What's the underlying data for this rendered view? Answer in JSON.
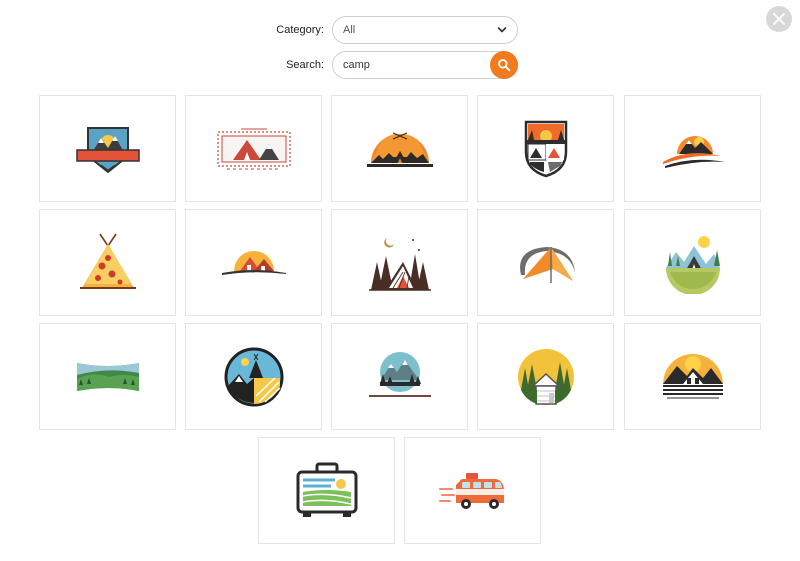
{
  "filters": {
    "category_label": "Category:",
    "category_value": "All",
    "search_label": "Search:",
    "search_value": "camp"
  },
  "icons": {
    "close": "close-icon",
    "dropdown": "chevron-down-icon",
    "search": "search-icon"
  },
  "colors": {
    "accent": "#f47a20",
    "close_bg": "#d8d8d8",
    "tile_border": "#e4e4e4"
  },
  "results": [
    {
      "logo": "mountain-badge-logo"
    },
    {
      "logo": "tent-stamp-logo"
    },
    {
      "logo": "sunset-tent-semicircle-logo"
    },
    {
      "logo": "camp-shield-logo"
    },
    {
      "logo": "mountain-swoosh-logo"
    },
    {
      "logo": "pizza-teepee-logo"
    },
    {
      "logo": "cabin-sunrise-logo"
    },
    {
      "logo": "forest-tent-moon-logo"
    },
    {
      "logo": "orange-canopy-tent-logo"
    },
    {
      "logo": "meadow-tent-circle-logo"
    },
    {
      "logo": "forest-banner-logo"
    },
    {
      "logo": "teepee-field-circle-logo"
    },
    {
      "logo": "mountain-lake-circle-logo"
    },
    {
      "logo": "forest-cabin-circle-logo"
    },
    {
      "logo": "mountain-house-sunset-logo"
    },
    {
      "logo": "travel-suitcase-logo"
    },
    {
      "logo": "camper-van-logo"
    }
  ]
}
